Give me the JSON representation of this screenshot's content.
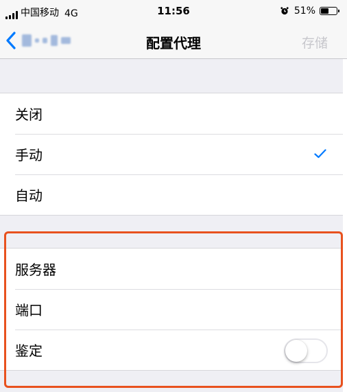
{
  "status_bar": {
    "carrier": "中国移动",
    "network": "4G",
    "time": "11:56",
    "battery_percent": "51%",
    "battery_level": 0.51
  },
  "nav": {
    "title": "配置代理",
    "save_label": "存储",
    "back_icon": "chevron-left-icon"
  },
  "proxy_modes": [
    {
      "label": "关闭",
      "checked": false
    },
    {
      "label": "手动",
      "checked": true
    },
    {
      "label": "自动",
      "checked": false
    }
  ],
  "manual_settings": {
    "server_label": "服务器",
    "port_label": "端口",
    "auth_label": "鉴定",
    "auth_enabled": false
  },
  "colors": {
    "accent": "#007aff",
    "highlight": "#e8511e",
    "background": "#efeff4"
  }
}
